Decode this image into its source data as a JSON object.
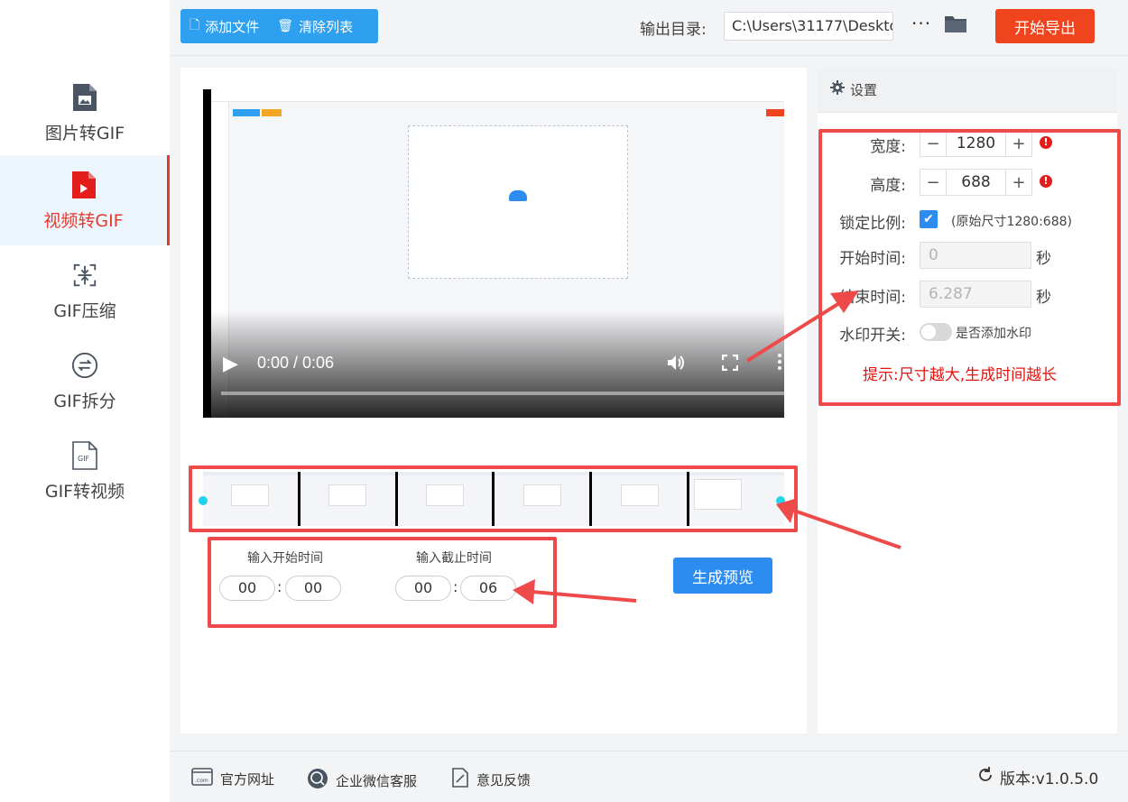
{
  "sidebar": {
    "items": [
      {
        "label": "图片转GIF",
        "icon": "image-file-icon"
      },
      {
        "label": "视频转GIF",
        "icon": "video-file-icon",
        "active": true
      },
      {
        "label": "GIF压缩",
        "icon": "compress-icon"
      },
      {
        "label": "GIF拆分",
        "icon": "split-icon"
      },
      {
        "label": "GIF转视频",
        "icon": "gif-file-icon"
      }
    ]
  },
  "toolbar": {
    "add_file": "添加文件",
    "clear_list": "清除列表",
    "output_label": "输出目录:",
    "output_path": "C:\\Users\\31177\\Deskto",
    "more": "···",
    "export": "开始导出"
  },
  "player": {
    "time": "0:00 / 0:06"
  },
  "trim": {
    "start_label": "输入开始时间",
    "end_label": "输入截止时间",
    "start_min": "00",
    "start_sec": "00",
    "end_min": "00",
    "end_sec": "06",
    "separator": ":",
    "preview_button": "生成预览"
  },
  "settings": {
    "title": "设置",
    "width_label": "宽度:",
    "width": "1280",
    "height_label": "高度:",
    "height": "688",
    "lock_label": "锁定比例:",
    "lock_checked": true,
    "original_size": "(原始尺寸1280:688)",
    "start_label": "开始时间:",
    "start_value": "0",
    "end_label": "结束时间:",
    "end_value": "6.287",
    "unit": "秒",
    "watermark_label": "水印开关:",
    "watermark_note": "是否添加水印",
    "watermark_on": false,
    "hint": "提示:尺寸越大,生成时间越长",
    "stepper_minus": "−",
    "stepper_plus": "+",
    "warn_mark": "!"
  },
  "footer": {
    "website": "官方网址",
    "support": "企业微信客服",
    "feedback": "意见反馈",
    "version": "版本:v1.0.5.0"
  },
  "colors": {
    "accent_blue": "#2d8cf0",
    "export_red": "#f0441f",
    "active_red": "#e33a2d",
    "annotation_red": "#ef4a4a"
  }
}
